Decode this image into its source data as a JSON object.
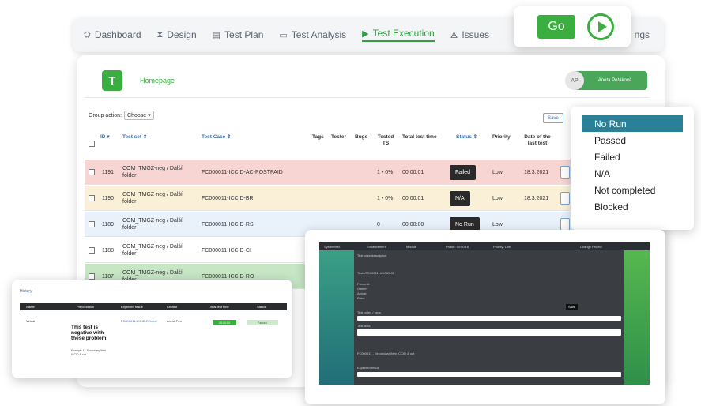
{
  "nav": {
    "items": [
      {
        "label": "Dashboard",
        "icon": "dashboard-icon",
        "glyph": "⛭"
      },
      {
        "label": "Design",
        "icon": "hourglass-icon",
        "glyph": "⧗"
      },
      {
        "label": "Test Plan",
        "icon": "clipboard-icon",
        "glyph": "▤"
      },
      {
        "label": "Test Analysis",
        "icon": "toolbox-icon",
        "glyph": "▭"
      },
      {
        "label": "Test Execution",
        "icon": "play-icon",
        "glyph": "▶"
      },
      {
        "label": "Issues",
        "icon": "bug-icon",
        "glyph": "🜁"
      }
    ],
    "tail_label": "ngs"
  },
  "go": {
    "label": "Go"
  },
  "header": {
    "home": "Homepage",
    "avatar": "AP",
    "user": "Aneta Petáková",
    "logo": "T"
  },
  "toolbar": {
    "group_label": "Group action:",
    "group_value": "Choose",
    "save_label": "Save"
  },
  "table": {
    "columns": {
      "id": "ID ▾",
      "test_set": "Test set ⇕",
      "test_case": "Test Case ⇕",
      "tags": "Tags",
      "tester": "Tester",
      "bugs": "Bugs",
      "tested": "Tested TS",
      "total": "Total test time",
      "status": "Status ⇕",
      "priority": "Priority",
      "date": "Date of the last test"
    },
    "rows": [
      {
        "id": "1191",
        "set": "COM_TMGZ-neg / Další folder",
        "case": "FC000011-ICCID-AC-POSTPAID",
        "tested": "1 • 0%",
        "time": "00:00:01",
        "status": "Failed",
        "priority": "Low",
        "date": "18.3.2021",
        "bg": "#f6d5d3"
      },
      {
        "id": "1190",
        "set": "COM_TMGZ-neg / Další folder",
        "case": "FC000011-ICCID-BR",
        "tested": "1 • 0%",
        "time": "00:00:01",
        "status": "N/A",
        "priority": "Low",
        "date": "18.3.2021",
        "bg": "#faf0d8"
      },
      {
        "id": "1189",
        "set": "COM_TMGZ-neg / Další folder",
        "case": "FC000011-ICCID-RS",
        "tested": "0",
        "time": "00:00:00",
        "status": "No Run",
        "priority": "Low",
        "date": "",
        "bg": "#e9f1fa"
      },
      {
        "id": "1188",
        "set": "COM_TMGZ-neg / Další folder",
        "case": "FC000011-ICCID-CI",
        "tested": "",
        "time": "",
        "status": "",
        "priority": "",
        "date": "",
        "bg": "#ffffff"
      },
      {
        "id": "1187",
        "set": "COM_TMGZ-neg / Další folder",
        "case": "FC000011-ICCID-RO",
        "tested": "",
        "time": "",
        "status": "",
        "priority": "",
        "date": "",
        "bg": "#c6e6c4"
      }
    ]
  },
  "status_menu": {
    "options": [
      "No Run",
      "Passed",
      "Failed",
      "N/A",
      "Not completed",
      "Blocked"
    ],
    "selected": "No Run"
  },
  "dark_view": {
    "top_labels": [
      "Systemtest",
      "Enhancement",
      "Module",
      "Phase: 00:00:16",
      "Priority: Low",
      "Change Project"
    ],
    "lines": [
      "Test case description",
      "Tests/FC000011-ICCID-CI",
      "Precond:",
      "Owner:",
      "Actual:",
      "Field:",
      "Test notes / error",
      "Test area",
      "FC000011 - Secondary Item ICCID & out",
      "Expected result"
    ],
    "button": "Save"
  },
  "light_view": {
    "link": "History",
    "headers": [
      "Name",
      "Precondition",
      "Expected result",
      "Creator",
      "Total test time",
      "Status"
    ],
    "row_name": "Virtual",
    "row_expected": "FC000011-ICCID-RO-null",
    "row_creator": "Aneta Petr",
    "big_text": "This test is negative with these problem:",
    "small_text": "Example 1 - Secondary Item ICCID & out",
    "time_value": "00:00:10",
    "status_value": "Passed"
  },
  "colors": {
    "accent": "#3aae3f",
    "link": "#3a6fb0",
    "dropdown_selected": "#2b7f96"
  }
}
